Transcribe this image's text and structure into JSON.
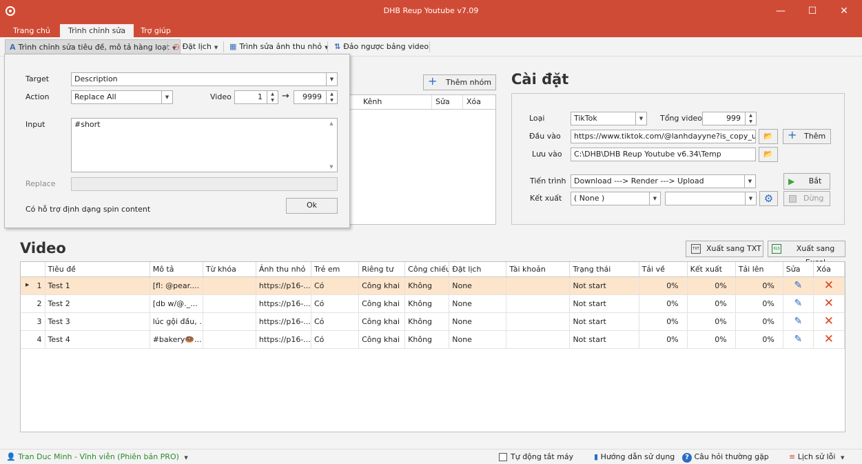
{
  "window": {
    "title": "DHB Reup Youtube v7.09"
  },
  "tabs": [
    "Trang chủ",
    "Trình chỉnh sửa",
    "Trợ giúp"
  ],
  "toolbar": {
    "items": [
      {
        "label": "Trình chỉnh sửa tiêu đề, mô tả hàng loạt",
        "icon": "text-a-icon"
      },
      {
        "label": "Đặt lịch",
        "icon": "clock-icon"
      },
      {
        "label": "Trình sửa ảnh thu nhỏ",
        "icon": "image-edit-icon"
      },
      {
        "label": "Đảo ngược bảng video",
        "icon": "sort-reverse-icon"
      }
    ]
  },
  "popup": {
    "target_label": "Target",
    "target_value": "Description",
    "action_label": "Action",
    "action_value": "Replace All",
    "video_label": "Video",
    "video_from": "1",
    "arrow": "→",
    "video_to": "9999",
    "input_label": "Input",
    "input_value": "#short",
    "replace_label": "Replace",
    "replace_value": "",
    "note": "Có hỗ trợ định dạng spin content",
    "ok_label": "Ok"
  },
  "group": {
    "add_group_label": "Thêm nhóm",
    "columns": [
      "Kênh",
      "Sửa",
      "Xóa"
    ]
  },
  "settings": {
    "title": "Cài đặt",
    "type_label": "Loại",
    "type_value": "TikTok",
    "total_label": "Tổng video",
    "total_value": "999",
    "input_label": "Đầu vào",
    "input_value": "https://www.tiktok.com/@lanhdayyne?is_copy_url=1&",
    "add_label": "Thêm",
    "save_label": "Lưu vào",
    "save_value": "C:\\DHB\\DHB Reup Youtube v6.34\\Temp",
    "process_label": "Tiến trình",
    "process_value": "Download ---> Render ---> Upload",
    "start_label": "Bắt đầu",
    "export_label": "Kết xuất",
    "export_value": "( None )",
    "export_value2": "",
    "stop_label": "Dừng"
  },
  "video": {
    "title": "Video",
    "export_txt": "Xuất sang TXT",
    "export_excel": "Xuất sang Excel",
    "columns": [
      "Tiêu đề",
      "Mô tả",
      "Từ khóa",
      "Ảnh thu nhỏ",
      "Trẻ em",
      "Riêng tư",
      "Công chiếu",
      "Đặt lịch",
      "Tài khoản",
      "Trạng thái",
      "Tải về",
      "Kết xuất",
      "Tải lên",
      "Sửa",
      "Xóa"
    ],
    "rows": [
      {
        "idx": "1",
        "title": "Test 1",
        "desc": "[fl: @pear....",
        "keywords": "",
        "thumb": "https://p16-...",
        "kids": "Có",
        "privacy": "Công khai",
        "premiere": "Không",
        "schedule": "None",
        "account": "",
        "status": "Not start",
        "dl": "0%",
        "render": "0%",
        "up": "0%"
      },
      {
        "idx": "2",
        "title": "Test 2",
        "desc": "[db w/@._...",
        "keywords": "",
        "thumb": "https://p16-...",
        "kids": "Có",
        "privacy": "Công khai",
        "premiere": "Không",
        "schedule": "None",
        "account": "",
        "status": "Not start",
        "dl": "0%",
        "render": "0%",
        "up": "0%"
      },
      {
        "idx": "3",
        "title": "Test 3",
        "desc": "lúc gội đầu, ...",
        "keywords": "",
        "thumb": "https://p16-...",
        "kids": "Có",
        "privacy": "Công khai",
        "premiere": "Không",
        "schedule": "None",
        "account": "",
        "status": "Not start",
        "dl": "0%",
        "render": "0%",
        "up": "0%"
      },
      {
        "idx": "4",
        "title": "Test 4",
        "desc": "#bakery🍩...",
        "keywords": "",
        "thumb": "https://p16-...",
        "kids": "Có",
        "privacy": "Công khai",
        "premiere": "Không",
        "schedule": "None",
        "account": "",
        "status": "Not start",
        "dl": "0%",
        "render": "0%",
        "up": "0%"
      }
    ]
  },
  "status": {
    "user": "Tran Duc Minh - Vĩnh viễn (Phiên bản PRO)",
    "auto_shutdown": "Tự động tắt máy",
    "guide": "Hướng dẫn sử dụng",
    "faq": "Câu hỏi thường gặp",
    "error_log": "Lịch sử lỗi"
  },
  "colors": {
    "titlebar": "#d04b35",
    "selected_row": "#fde5cc",
    "accent": "#2b6cc4",
    "delete": "#e0421c"
  }
}
